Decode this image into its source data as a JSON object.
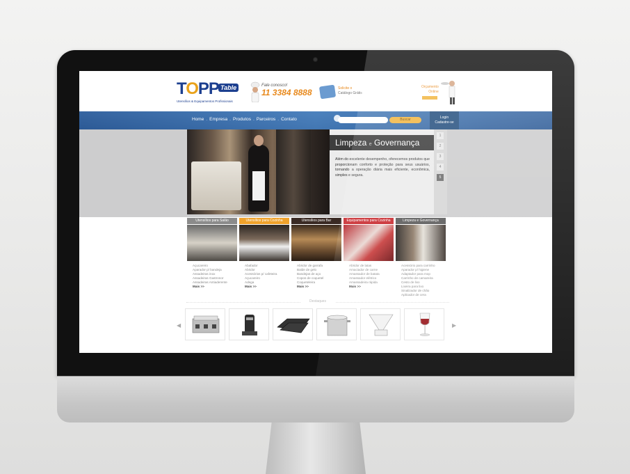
{
  "site": {
    "logo": {
      "word_a": "T",
      "word_o": "O",
      "word_b": "PP",
      "table_word": "Table",
      "tagline": "Utensílios & Equipamentos Profissionais"
    },
    "phone": {
      "label": "Fale conosco!",
      "number": "11 3384 8888"
    },
    "catalog": {
      "line1": "Solicite o",
      "line2": "Catálogo Grátis"
    },
    "quote": {
      "line1": "Orçamento",
      "line2": "Online"
    },
    "nav": [
      "Home",
      "Empresa",
      "Produtos",
      "Parceiros",
      "Contato"
    ],
    "nav_separator": ".",
    "search": {
      "placeholder": "",
      "button": "Buscar"
    },
    "login": {
      "line1": "Login",
      "line2": "Cadastre-se"
    },
    "hero": {
      "title_a": "Limpeza",
      "title_conj": "e",
      "title_b": "Governança",
      "description": "Além do excelente desempenho, oferecemos produtos que proporcionam conforto e proteção para seus usuários, tornando a operação diária mais eficiente, econômica, simples e segura.",
      "pages": [
        "1",
        "2",
        "3",
        "4",
        "5"
      ]
    },
    "categories": [
      {
        "title": "Utensílios para Salão",
        "color": "#8b8b8b",
        "items": [
          "Açucareiro",
          "Aparador p/ bandeja",
          "Assadeiras inox",
          "Assadeiras Gastronor",
          "Assadeiras Antiaderente"
        ],
        "more": "Mais >>"
      },
      {
        "title": "Utensílios para Cozinha",
        "color": "#f0a22b",
        "items": [
          "Abafador",
          "Abridor",
          "Acessórios p/ cafeteira",
          "Açucareiro",
          "Adega"
        ],
        "more": "Mais >>"
      },
      {
        "title": "Utensílios para Bar",
        "color": "#3a2a24",
        "items": [
          "Abridor de garrafa",
          "Balde de gelo",
          "Bandejas de aço",
          "Copos de coquetel",
          "Coqueteleira"
        ],
        "more": "Mais >>"
      },
      {
        "title": "Equipamentos para Cozinha",
        "color": "#c8282c",
        "items": [
          "Abridor de latas",
          "Amaciador de carne",
          "Amassador de batata",
          "Amassador elétrico",
          "Amassadeira rápida"
        ],
        "more": "Mais >>"
      },
      {
        "title": "Limpeza e Governança",
        "color": "#5a5a5a",
        "items": [
          "Acessório para carrinho",
          "Aparador p/ higiene",
          "Adaptador para mop",
          "Carrinho de camareira",
          "Cesto de lixo",
          "Lixeira para lixo",
          "Sinalizador de chão",
          "Aplicador de cera"
        ],
        "more": ""
      }
    ],
    "destaques_label": "Destaques",
    "arrow_left": "◀",
    "arrow_right": "▶",
    "products": [
      "steam-table",
      "coffee-urn",
      "serving-tray",
      "stock-pot",
      "cocktail-glass",
      "wine-glass"
    ]
  },
  "colors": {
    "nav_blue": "#2f5f9a",
    "brand_blue": "#1c3f8f",
    "accent_orange": "#e8891c"
  }
}
